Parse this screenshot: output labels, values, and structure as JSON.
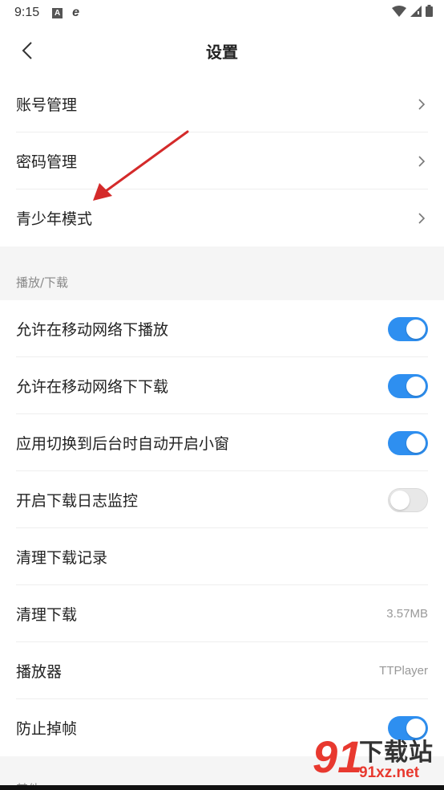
{
  "status_bar": {
    "time": "9:15",
    "icons": [
      "a-icon",
      "e-browser-icon",
      "wifi-icon",
      "signal-icon",
      "battery-icon"
    ]
  },
  "nav": {
    "title": "设置"
  },
  "account_section": [
    {
      "label": "账号管理"
    },
    {
      "label": "密码管理"
    },
    {
      "label": "青少年模式"
    }
  ],
  "playback_section": {
    "title": "播放/下载",
    "items": [
      {
        "label": "允许在移动网络下播放",
        "toggle": true
      },
      {
        "label": "允许在移动网络下下载",
        "toggle": true
      },
      {
        "label": "应用切换到后台时自动开启小窗",
        "toggle": true
      },
      {
        "label": "开启下载日志监控",
        "toggle": false
      },
      {
        "label": "清理下载记录"
      },
      {
        "label": "清理下载",
        "value": "3.57MB"
      },
      {
        "label": "播放器",
        "value": "TTPlayer"
      },
      {
        "label": "防止掉帧",
        "toggle": true
      }
    ]
  },
  "other_section": {
    "title": "其他"
  },
  "watermark": {
    "number": "91",
    "title": "下载站",
    "url": "91xz.net"
  },
  "colors": {
    "toggle_on": "#2e8ff0",
    "annotation_arrow": "#d42a2a"
  }
}
